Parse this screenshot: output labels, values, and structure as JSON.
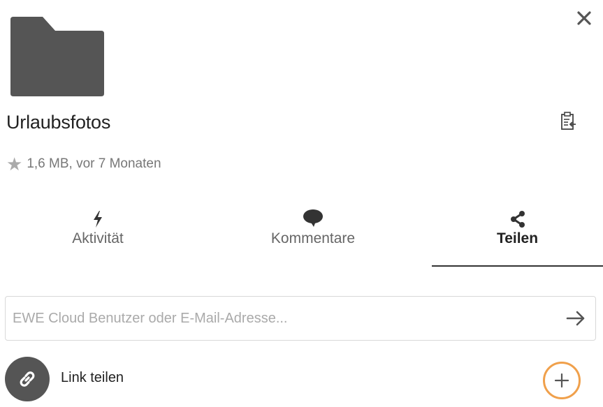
{
  "file": {
    "name": "Urlaubsfotos",
    "size": "1,6 MB",
    "modified": "vor 7 Monaten"
  },
  "meta_separator": ", ",
  "tabs": [
    {
      "id": "activity",
      "label": "Aktivität",
      "icon": "lightning-icon",
      "active": false
    },
    {
      "id": "comments",
      "label": "Kommentare",
      "icon": "comment-bubble-icon",
      "active": false
    },
    {
      "id": "sharing",
      "label": "Teilen",
      "icon": "share-icon",
      "active": true
    }
  ],
  "share": {
    "placeholder": "EWE Cloud Benutzer oder E-Mail-Adresse...",
    "value": "",
    "link_label": "Link teilen"
  },
  "colors": {
    "folder": "#555555",
    "highlight_ring": "#f0a04b",
    "active_tab_underline": "#333333"
  }
}
